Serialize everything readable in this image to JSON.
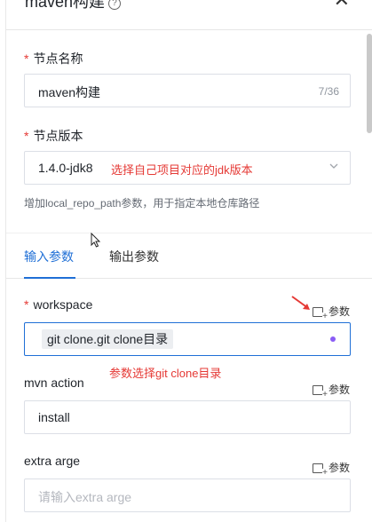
{
  "header": {
    "title": "maven构建",
    "help_icon": "question-circle-icon",
    "close_icon": "close-icon"
  },
  "form": {
    "node_name": {
      "label": "节点名称",
      "required": "*",
      "value": "maven构建",
      "count": "7/36"
    },
    "node_version": {
      "label": "节点版本",
      "required": "*",
      "value": "1.4.0-jdk8",
      "annotation": "选择自己项目对应的jdk版本",
      "hint": "增加local_repo_path参数，用于指定本地仓库路径"
    }
  },
  "tabs": [
    {
      "label": "输入参数",
      "active": true
    },
    {
      "label": "输出参数",
      "active": false
    }
  ],
  "params": {
    "param_label": "参数",
    "workspace": {
      "label": "workspace",
      "required": "*",
      "tag": "git clone.git clone目录",
      "annotation": "参数选择git clone目录"
    },
    "mvn_action": {
      "label": "mvn action",
      "value": "install"
    },
    "extra_arge": {
      "label": "extra arge",
      "placeholder": "请输入extra arge"
    }
  },
  "colors": {
    "accent": "#1f6fd6",
    "annotation": "#e53935",
    "variable_dot": "#8a5cf5"
  }
}
